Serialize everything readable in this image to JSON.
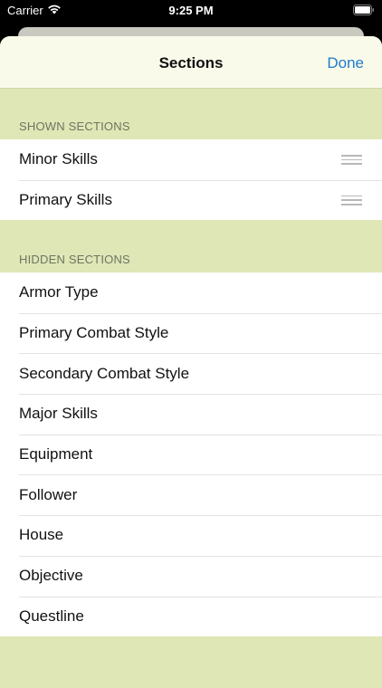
{
  "status_bar": {
    "carrier": "Carrier",
    "time": "9:25 PM",
    "wifi_icon": "wifi-icon",
    "battery_icon": "battery-icon"
  },
  "nav": {
    "title": "Sections",
    "done_label": "Done"
  },
  "shown_sections": {
    "header": "SHOWN SECTIONS",
    "items": [
      {
        "label": "Minor Skills",
        "icon": "reorder-grip-icon"
      },
      {
        "label": "Primary Skills",
        "icon": "reorder-grip-icon"
      }
    ]
  },
  "hidden_sections": {
    "header": "HIDDEN SECTIONS",
    "items": [
      {
        "label": "Armor Type"
      },
      {
        "label": "Primary Combat Style"
      },
      {
        "label": "Secondary Combat Style"
      },
      {
        "label": "Major Skills"
      },
      {
        "label": "Equipment"
      },
      {
        "label": "Follower"
      },
      {
        "label": "House"
      },
      {
        "label": "Objective"
      },
      {
        "label": "Questline"
      }
    ]
  },
  "colors": {
    "sheet_background": "#dfe7b6",
    "nav_background": "#f9faea",
    "accent": "#1f7ccf"
  }
}
